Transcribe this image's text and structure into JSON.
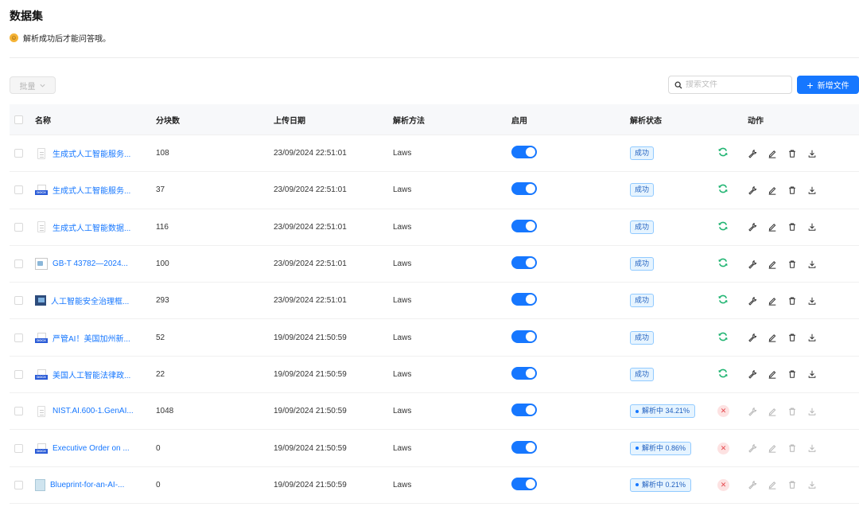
{
  "page": {
    "title": "数据集",
    "hint": "解析成功后才能问答哦。"
  },
  "toolbar": {
    "bulk_label": "批量",
    "search_placeholder": "搜索文件",
    "new_file_label": "新增文件"
  },
  "table": {
    "headers": {
      "name": "名称",
      "chunks": "分块数",
      "upload_date": "上传日期",
      "parse_method": "解析方法",
      "enabled": "启用",
      "parse_status": "解析状态",
      "actions": "动作"
    },
    "rows": [
      {
        "name": "生成式人工智能服务...",
        "icon": "plain",
        "chunks": "108",
        "date": "23/09/2024 22:51:01",
        "method": "Laws",
        "enabled": true,
        "status": "成功",
        "state": "done"
      },
      {
        "name": "生成式人工智能服务...",
        "icon": "docx",
        "chunks": "37",
        "date": "23/09/2024 22:51:01",
        "method": "Laws",
        "enabled": true,
        "status": "成功",
        "state": "done"
      },
      {
        "name": "生成式人工智能数据...",
        "icon": "plain",
        "chunks": "116",
        "date": "23/09/2024 22:51:01",
        "method": "Laws",
        "enabled": true,
        "status": "成功",
        "state": "done"
      },
      {
        "name": "GB-T 43782—2024...",
        "icon": "img",
        "chunks": "100",
        "date": "23/09/2024 22:51:01",
        "method": "Laws",
        "enabled": true,
        "status": "成功",
        "state": "done"
      },
      {
        "name": "人工智能安全治理框...",
        "icon": "photo",
        "chunks": "293",
        "date": "23/09/2024 22:51:01",
        "method": "Laws",
        "enabled": true,
        "status": "成功",
        "state": "done"
      },
      {
        "name": "严管AI！美国加州新...",
        "icon": "docx",
        "chunks": "52",
        "date": "19/09/2024 21:50:59",
        "method": "Laws",
        "enabled": true,
        "status": "成功",
        "state": "done"
      },
      {
        "name": "美国人工智能法律政...",
        "icon": "docx",
        "chunks": "22",
        "date": "19/09/2024 21:50:59",
        "method": "Laws",
        "enabled": true,
        "status": "成功",
        "state": "done"
      },
      {
        "name": "NIST.AI.600-1.GenAI...",
        "icon": "plain",
        "chunks": "1048",
        "date": "19/09/2024 21:50:59",
        "method": "Laws",
        "enabled": true,
        "status": "解析中 34.21%",
        "state": "running"
      },
      {
        "name": "Executive Order on ...",
        "icon": "docx",
        "chunks": "0",
        "date": "19/09/2024 21:50:59",
        "method": "Laws",
        "enabled": true,
        "status": "解析中 0.86%",
        "state": "running"
      },
      {
        "name": "Blueprint-for-an-AI-...",
        "icon": "doc",
        "chunks": "0",
        "date": "19/09/2024 21:50:59",
        "method": "Laws",
        "enabled": true,
        "status": "解析中 0.21%",
        "state": "running"
      }
    ]
  },
  "icons": {
    "docx_label": "DOCX"
  },
  "colors": {
    "accent": "#1677ff",
    "success": "#22b573",
    "danger": "#e5484d"
  }
}
